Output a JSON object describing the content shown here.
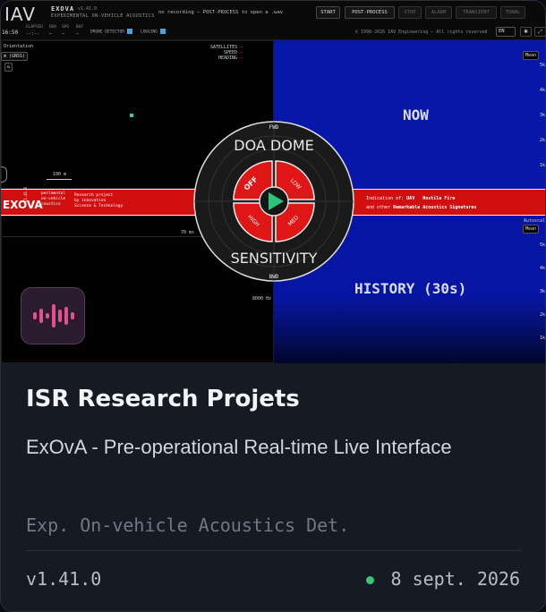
{
  "app": {
    "logo": "IAV",
    "name": "EXOVA",
    "version": "v1.41.0",
    "subtitle": "EXPERIMENTAL ON-VEHICLE ACOUSTICS",
    "record_status": "no recording — POST-PROCESS to open a .wav",
    "clock": "16:50",
    "metrics": [
      {
        "label": "ELAPSED",
        "value": "--:--"
      },
      {
        "label": "DOA",
        "value": "—"
      },
      {
        "label": "SPS",
        "value": "—"
      },
      {
        "label": "BUF",
        "value": "—"
      }
    ],
    "checks": {
      "drone_detector": "DRONE DETECTOR",
      "logging": "LOGGING"
    },
    "buttons": {
      "start": "START",
      "post_process": "POST-PROCESS",
      "stop": "STOP",
      "alarm": "ALARM",
      "transient": "TRANSIENT",
      "tonal": "TONAL"
    },
    "copyright": "© 1998-2026 IAV Engineering — All rights reserved",
    "language": "EN"
  },
  "map_pane": {
    "orientation_label": "Orientation",
    "orientation_value": "m (GNSS)",
    "satellites": "SATELLITES",
    "speed": "SPEED",
    "heading": "HEADING",
    "scale": "100 m"
  },
  "now_pane": {
    "label": "NOW",
    "mode": "Mean",
    "y_ticks": [
      "5k",
      "4k",
      "3k",
      "2k",
      "1k"
    ]
  },
  "history_pane": {
    "label": "HISTORY (30s)",
    "autoscale": "Autoscal",
    "mode": "Mean",
    "y_ticks": [
      "5k",
      "4k",
      "3k",
      "2k",
      "1k"
    ]
  },
  "spectrum_pane": {
    "time_label": "70 ms",
    "freq_label": "8000 Hz"
  },
  "banner": {
    "logo": "EXOVA",
    "version_vertical": "v1.41.0",
    "lines_left": [
      "perimental",
      "on-vehicle",
      "coustics"
    ],
    "lines_mid": [
      "Research project",
      "by innovation",
      "Science & Technology"
    ],
    "right_line1_label": "Indication of:",
    "right_line1_a": "UAV",
    "right_line1_b": "Hostile Fire",
    "right_line2_label": "and other",
    "right_line2_b": "Remarkable Acoustics Signatures"
  },
  "dial": {
    "top_label": "FWD",
    "bottom_label": "BWD",
    "doa_label": "DOA DOME",
    "sensitivity_label": "SENSITIVITY",
    "segments": [
      "OFF",
      "LOW",
      "HIGH",
      "MED"
    ]
  },
  "card": {
    "title": "ISR Research Projets",
    "description": "ExOvA - Pre-operational Real-time Live Interface",
    "subtitle": "Exp. On-vehicle Acoustics Det.",
    "version": "v1.41.0",
    "date": "8 sept. 2026",
    "status_color": "#35c77a",
    "accent_color": "#e0528f",
    "badge_icon": "audio-waveform-icon"
  }
}
